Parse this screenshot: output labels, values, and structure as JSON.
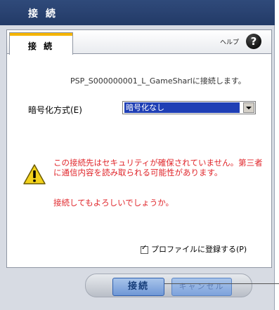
{
  "window": {
    "title": "接 続"
  },
  "tab": {
    "label": "接 続"
  },
  "help": {
    "label": "ヘルプ",
    "icon": "?"
  },
  "message": "PSP_S000000001_L_GameSharlに接続します。",
  "encryption": {
    "label": "暗号化方式(E)",
    "selected": "暗号化なし"
  },
  "warning": {
    "text": "この接続先はセキュリティが確保されていません。第三者に通信内容を読み取られる可能性があります。",
    "confirm": "接続してもよろしいでしょうか。"
  },
  "profile_checkbox": {
    "label": "プロファイルに登録する(P)",
    "checked": true
  },
  "buttons": {
    "connect": "接続",
    "cancel": "キャンセル"
  },
  "colors": {
    "title_bar": "#2a4372",
    "warning_text": "#e0262b",
    "tab_accent": "#f5b400",
    "select_highlight": "#1f3fb5"
  }
}
